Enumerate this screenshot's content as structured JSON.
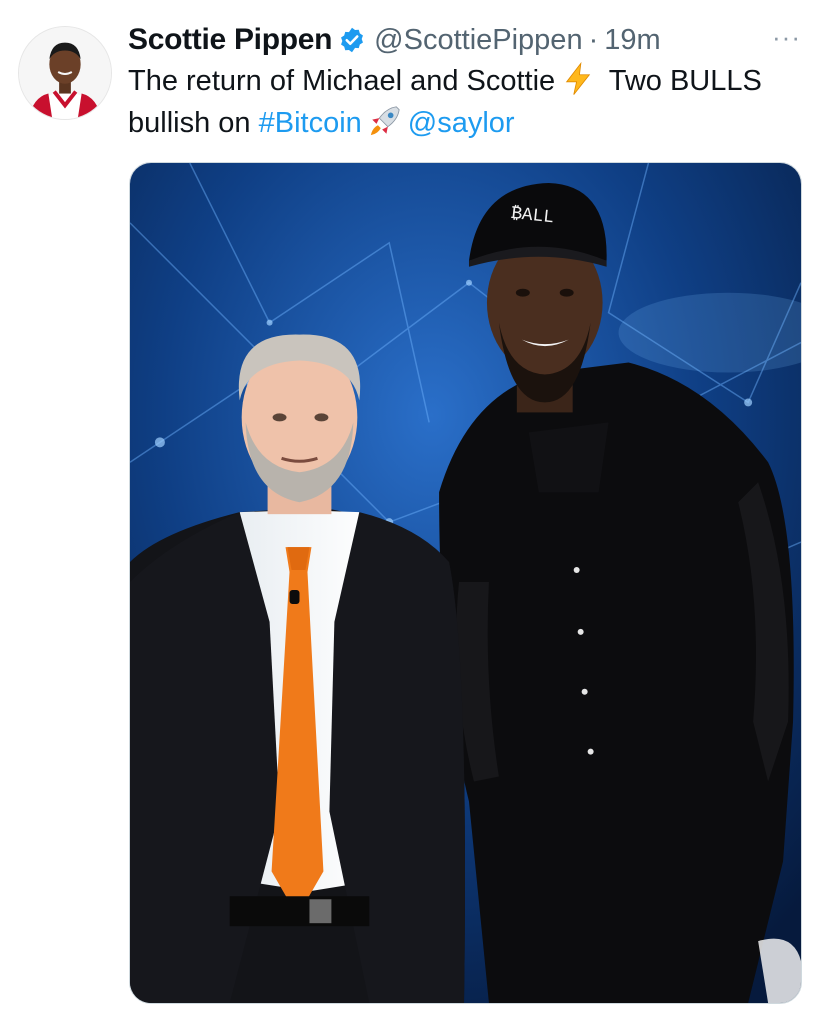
{
  "tweet": {
    "author_name": "Scottie Pippen",
    "handle": "@ScottiePippen",
    "separator": "·",
    "time": "19m",
    "more_label": "···",
    "text_part1": "The return of Michael and Scottie",
    "text_part2": "Two BULLS bullish on",
    "hashtag": "#Bitcoin",
    "mention": "@saylor",
    "emoji_1": "lightning-emoji",
    "emoji_2": "rocket-emoji",
    "hat_text": "₿ALL"
  },
  "colors": {
    "link": "#1d9bf0",
    "verified": "#1d9bf0",
    "secondary_text": "#536471",
    "tie": "#f07a1a",
    "backdrop": "#0b3a7a"
  }
}
